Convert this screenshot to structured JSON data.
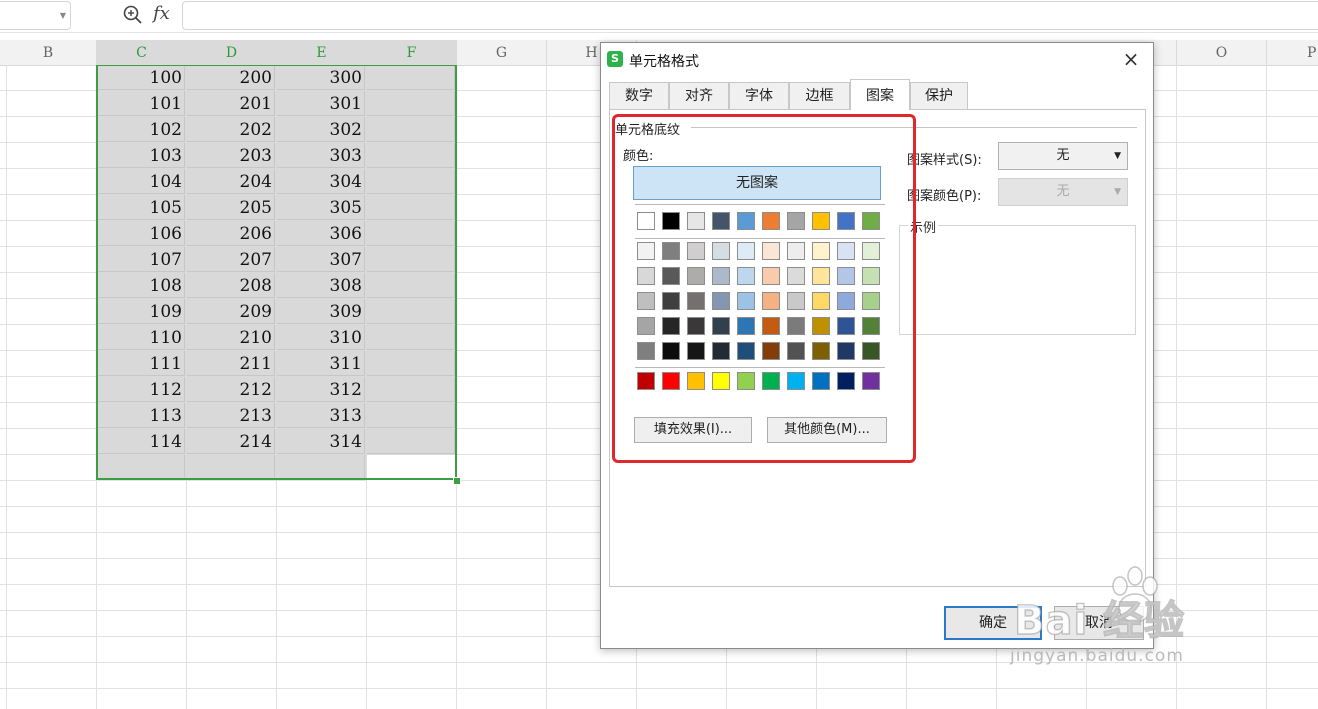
{
  "formula_bar": {
    "function_icon": "fx",
    "zoom_icon": "zoom-in-icon"
  },
  "columns": [
    "B",
    "C",
    "D",
    "E",
    "F",
    "G",
    "H",
    "O",
    "P"
  ],
  "cells": [
    {
      "c": "100",
      "d": "200",
      "e": "300"
    },
    {
      "c": "101",
      "d": "201",
      "e": "301"
    },
    {
      "c": "102",
      "d": "202",
      "e": "302"
    },
    {
      "c": "103",
      "d": "203",
      "e": "303"
    },
    {
      "c": "104",
      "d": "204",
      "e": "304"
    },
    {
      "c": "105",
      "d": "205",
      "e": "305"
    },
    {
      "c": "106",
      "d": "206",
      "e": "306"
    },
    {
      "c": "107",
      "d": "207",
      "e": "307"
    },
    {
      "c": "108",
      "d": "208",
      "e": "308"
    },
    {
      "c": "109",
      "d": "209",
      "e": "309"
    },
    {
      "c": "110",
      "d": "210",
      "e": "310"
    },
    {
      "c": "111",
      "d": "211",
      "e": "311"
    },
    {
      "c": "112",
      "d": "212",
      "e": "312"
    },
    {
      "c": "113",
      "d": "213",
      "e": "313"
    },
    {
      "c": "114",
      "d": "214",
      "e": "314"
    }
  ],
  "dialog": {
    "logo": "S",
    "title": "单元格格式",
    "close": "×",
    "tabs": [
      "数字",
      "对齐",
      "字体",
      "边框",
      "图案",
      "保护"
    ],
    "active_tab": "图案",
    "section_title": "单元格底纹",
    "color_label": "颜色:",
    "no_pattern": "无图案",
    "theme_row": [
      "#ffffff",
      "#000000",
      "#e7e6e6",
      "#44546a",
      "#5b9bd5",
      "#ed7d31",
      "#a5a5a5",
      "#ffc000",
      "#4472c4",
      "#70ad47"
    ],
    "tint_rows": [
      [
        "#f2f2f2",
        "#7f7f7f",
        "#d0cece",
        "#d6dce4",
        "#deebf6",
        "#fbe5d5",
        "#ededed",
        "#fff2cc",
        "#d9e2f3",
        "#e2efd9"
      ],
      [
        "#d8d8d8",
        "#595959",
        "#aeabab",
        "#adb9ca",
        "#bdd7ee",
        "#f7cbac",
        "#dbdbdb",
        "#fee599",
        "#b4c6e7",
        "#c5e0b3"
      ],
      [
        "#bfbfbf",
        "#3f3f3f",
        "#757070",
        "#8496b0",
        "#9cc3e5",
        "#f4b183",
        "#c9c9c9",
        "#ffd965",
        "#8eaadb",
        "#a8d08d"
      ],
      [
        "#a5a5a5",
        "#262626",
        "#3a3838",
        "#323f4f",
        "#2e75b5",
        "#c55a11",
        "#7b7b7b",
        "#bf9000",
        "#2f5496",
        "#538135"
      ],
      [
        "#7f7f7f",
        "#0c0c0c",
        "#171616",
        "#222a35",
        "#1e4e79",
        "#833c0b",
        "#525252",
        "#7f6000",
        "#1f3864",
        "#375623"
      ]
    ],
    "standard_row": [
      "#c00000",
      "#ff0000",
      "#ffc000",
      "#ffff00",
      "#92d050",
      "#00b050",
      "#00b0f0",
      "#0070c0",
      "#002060",
      "#7030a0"
    ],
    "fill_effects": "填充效果(I)...",
    "more_colors": "其他颜色(M)...",
    "pattern_style_label": "图案样式(S):",
    "pattern_style_value": "无",
    "pattern_color_label": "图案颜色(P):",
    "pattern_color_value": "无",
    "sample_label": "示例",
    "ok": "确定",
    "cancel": "取消"
  },
  "watermark": {
    "brand": "Bai 经验",
    "url": "jingyan.baidu.com"
  },
  "highlight_color": "#e0272c",
  "selection_color": "#3c9d43"
}
